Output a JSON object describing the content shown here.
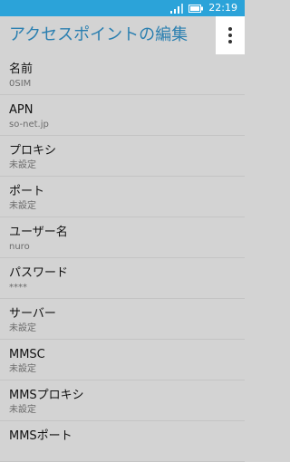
{
  "status": {
    "time": "22:19"
  },
  "app_bar": {
    "title": "アクセスポイントの編集"
  },
  "settings": [
    {
      "label": "名前",
      "value": "0SIM"
    },
    {
      "label": "APN",
      "value": "so-net.jp"
    },
    {
      "label": "プロキシ",
      "value": "未設定"
    },
    {
      "label": "ポート",
      "value": "未設定"
    },
    {
      "label": "ユーザー名",
      "value": "nuro"
    },
    {
      "label": "パスワード",
      "value": "****"
    },
    {
      "label": "サーバー",
      "value": "未設定"
    },
    {
      "label": "MMSC",
      "value": "未設定"
    },
    {
      "label": "MMSプロキシ",
      "value": "未設定"
    },
    {
      "label": "MMSポート",
      "value": ""
    }
  ],
  "colors": {
    "status_bar": "#2ba3d9",
    "title": "#2a7fb0",
    "background": "#d3d3d3"
  }
}
